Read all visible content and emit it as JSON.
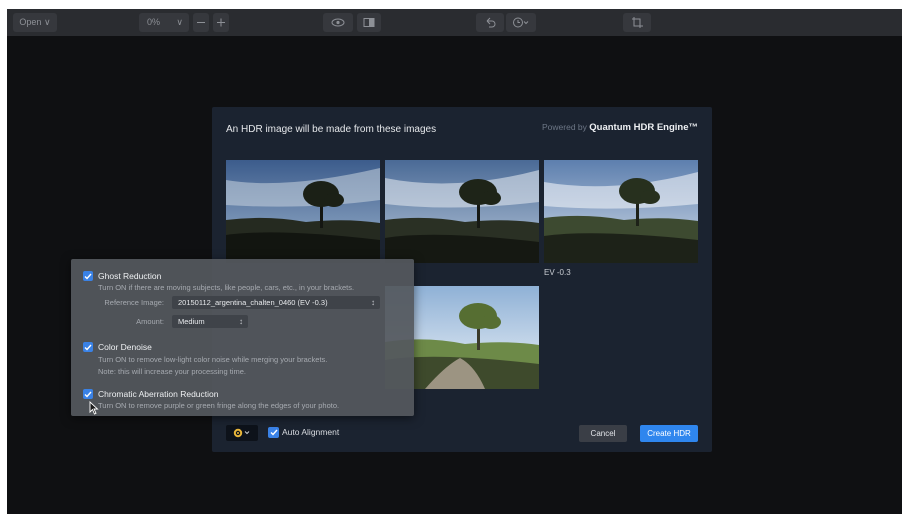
{
  "toolbar": {
    "open_label": "Open",
    "zoom_value": "0%",
    "icons": [
      "chevron-down-icon",
      "zoom-out-icon",
      "zoom-in-icon",
      "eye-icon",
      "compare-icon",
      "undo-icon",
      "history-icon",
      "crop-icon"
    ]
  },
  "dialog": {
    "title": "An HDR image will be made from these images",
    "powered_by": "Powered by",
    "engine": "Quantum HDR Engine™",
    "images": [
      {
        "label": ""
      },
      {
        "label": ""
      },
      {
        "label": "EV -0.3"
      },
      {
        "label": ""
      }
    ],
    "auto_alignment": {
      "label": "Auto Alignment",
      "checked": true
    },
    "cancel_label": "Cancel",
    "create_label": "Create HDR",
    "accent_color": "#2f86ee"
  },
  "settings": {
    "ghost": {
      "title": "Ghost Reduction",
      "checked": true,
      "desc": "Turn ON if there are moving subjects, like people, cars, etc., in your brackets.",
      "reference_label": "Reference Image:",
      "reference_value": "20150112_argentina_chalten_0460 (EV -0.3)",
      "amount_label": "Amount:",
      "amount_value": "Medium"
    },
    "denoise": {
      "title": "Color Denoise",
      "checked": true,
      "desc1": "Turn ON to remove low-light color noise while merging your brackets.",
      "desc2": "Note: this will increase your processing time."
    },
    "chromatic": {
      "title": "Chromatic Aberration Reduction",
      "checked": true,
      "desc": "Turn ON to remove purple or green fringe along the edges of your photo."
    }
  }
}
